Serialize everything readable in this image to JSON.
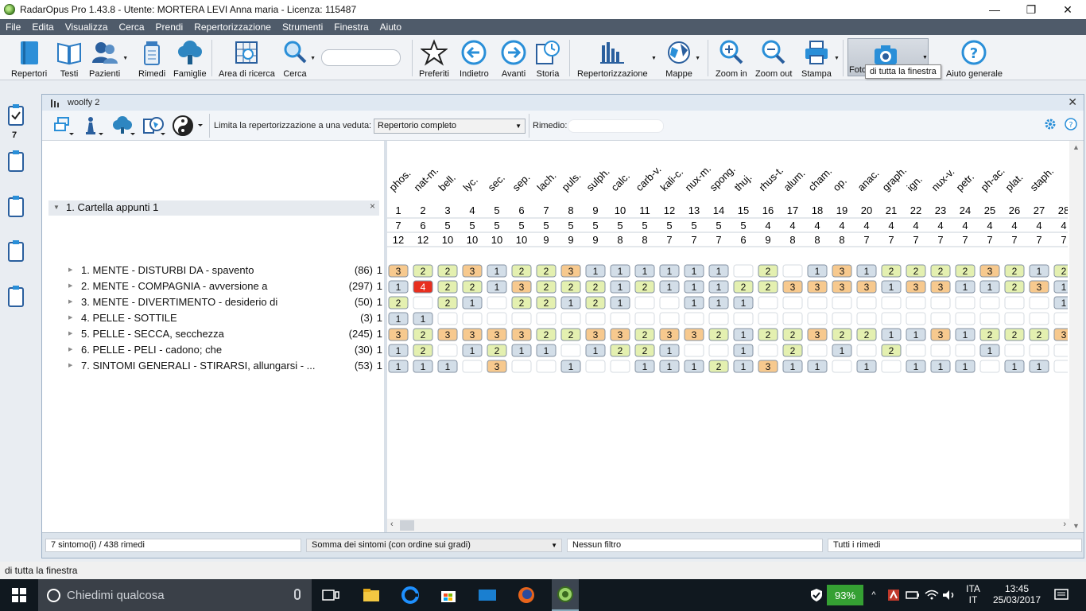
{
  "window": {
    "title": "RadarOpus Pro 1.43.8 - Utente: MORTERA LEVI Anna maria - Licenza: 115487"
  },
  "menu": [
    "File",
    "Edita",
    "Visualizza",
    "Cerca",
    "Prendi",
    "Repertorizzazione",
    "Strumenti",
    "Finestra",
    "Aiuto"
  ],
  "toolbar": {
    "repertori": "Repertori",
    "testi": "Testi",
    "pazienti": "Pazienti",
    "rimedi": "Rimedi",
    "famiglie": "Famiglie",
    "area_ricerca": "Area di ricerca",
    "cerca": "Cerca",
    "preferiti": "Preferiti",
    "indietro": "Indietro",
    "avanti": "Avanti",
    "storia": "Storia",
    "repertorizzazione": "Repertorizzazione",
    "mappe": "Mappe",
    "zoom_in": "Zoom in",
    "zoom_out": "Zoom out",
    "stampa": "Stampa",
    "foto": "Foto",
    "aiuto": "Aiuto generale",
    "tooltip": "di tutta la finestra"
  },
  "sidebar": {
    "clip_count": "7"
  },
  "panel": {
    "title": "woolfy 2",
    "limit_label": "Limita la repertorizzazione a una veduta:",
    "limit_value": "Repertorio completo",
    "rimedio_label": "Rimedio:",
    "folder": "1. Cartella appunti 1"
  },
  "symptoms": [
    {
      "text": "1. MENTE - DISTURBI DA - spavento",
      "count": "(86)",
      "w": "1"
    },
    {
      "text": "2. MENTE - COMPAGNIA - avversione a",
      "count": "(297)",
      "w": "1"
    },
    {
      "text": "3. MENTE - DIVERTIMENTO - desiderio di",
      "count": "(50)",
      "w": "1"
    },
    {
      "text": "4. PELLE - SOTTILE",
      "count": "(3)",
      "w": "1"
    },
    {
      "text": "5. PELLE - SECCA, secchezza",
      "count": "(245)",
      "w": "1"
    },
    {
      "text": "6. PELLE - PELI - cadono; che",
      "count": "(30)",
      "w": "1"
    },
    {
      "text": "7. SINTOMI GENERALI - STIRARSI, allungarsi - ...",
      "count": "(53)",
      "w": "1"
    }
  ],
  "remedies": [
    "phos.",
    "nat-m.",
    "bell.",
    "lyc.",
    "sec.",
    "sep.",
    "lach.",
    "puls.",
    "sulph.",
    "calc.",
    "carb-v.",
    "kali-c.",
    "nux-m.",
    "spong.",
    "thuj.",
    "rhus-t.",
    "alum.",
    "cham.",
    "op.",
    "anac.",
    "graph.",
    "ign.",
    "nux-v.",
    "petr.",
    "ph-ac.",
    "plat.",
    "staph.",
    ""
  ],
  "rank_row": [
    "1",
    "2",
    "3",
    "4",
    "5",
    "6",
    "7",
    "8",
    "9",
    "10",
    "11",
    "12",
    "13",
    "14",
    "15",
    "16",
    "17",
    "18",
    "19",
    "20",
    "21",
    "22",
    "23",
    "24",
    "25",
    "26",
    "27",
    "28"
  ],
  "symptoms_row": [
    "7",
    "6",
    "5",
    "5",
    "5",
    "5",
    "5",
    "5",
    "5",
    "5",
    "5",
    "5",
    "5",
    "5",
    "5",
    "4",
    "4",
    "4",
    "4",
    "4",
    "4",
    "4",
    "4",
    "4",
    "4",
    "4",
    "4",
    "4"
  ],
  "degrees_row": [
    "12",
    "12",
    "10",
    "10",
    "10",
    "10",
    "9",
    "9",
    "9",
    "8",
    "8",
    "7",
    "7",
    "7",
    "6",
    "9",
    "8",
    "8",
    "8",
    "7",
    "7",
    "7",
    "7",
    "7",
    "7",
    "7",
    "7",
    "7"
  ],
  "grades": [
    [
      "3",
      "2",
      "2",
      "3",
      "1",
      "2",
      "2",
      "3",
      "1",
      "1",
      "1",
      "1",
      "1",
      "1",
      "",
      "2",
      "",
      "1",
      "3",
      "1",
      "2",
      "2",
      "2",
      "2",
      "3",
      "2",
      "1",
      "2"
    ],
    [
      "1",
      "4",
      "2",
      "2",
      "1",
      "3",
      "2",
      "2",
      "2",
      "1",
      "2",
      "1",
      "1",
      "1",
      "2",
      "2",
      "3",
      "3",
      "3",
      "3",
      "1",
      "3",
      "3",
      "1",
      "1",
      "2",
      "3",
      "1"
    ],
    [
      "2",
      "",
      "2",
      "1",
      "",
      "2",
      "2",
      "1",
      "2",
      "1",
      "",
      "",
      "1",
      "1",
      "1",
      "",
      "",
      "",
      "",
      "",
      "",
      "",
      "",
      "",
      "",
      "",
      "",
      "1"
    ],
    [
      "1",
      "1",
      "",
      "",
      "",
      "",
      "",
      "",
      "",
      "",
      "",
      "",
      "",
      "",
      "",
      "",
      "",
      "",
      "",
      "",
      "",
      "",
      "",
      "",
      "",
      "",
      "",
      ""
    ],
    [
      "3",
      "2",
      "3",
      "3",
      "3",
      "3",
      "2",
      "2",
      "3",
      "3",
      "2",
      "3",
      "3",
      "2",
      "1",
      "2",
      "2",
      "3",
      "2",
      "2",
      "1",
      "1",
      "3",
      "1",
      "2",
      "2",
      "2",
      "3"
    ],
    [
      "1",
      "2",
      "",
      "1",
      "2",
      "1",
      "1",
      "",
      "1",
      "2",
      "2",
      "1",
      "",
      "",
      "1",
      "",
      "2",
      "",
      "1",
      "",
      "2",
      "",
      "",
      "",
      "1",
      "",
      "",
      ""
    ],
    [
      "1",
      "1",
      "1",
      "",
      "3",
      "",
      "",
      "1",
      "",
      "",
      "1",
      "1",
      "1",
      "2",
      "1",
      "3",
      "1",
      "1",
      "",
      "1",
      "",
      "1",
      "1",
      "1",
      "",
      "1",
      "1",
      ""
    ]
  ],
  "colors": {
    "g1": "#d3dee8",
    "g2": "#e4f0b0",
    "g3": "#f7c98e",
    "g4": "#e82f1f",
    "empty": "#ffffff"
  },
  "status": {
    "count": "7 sintomo(i) / 438 rimedi",
    "sort": "Somma dei sintomi (con ordine sui gradi)",
    "filter": "Nessun filtro",
    "remedies": "Tutti i rimedi"
  },
  "hint": "di tutta la finestra",
  "taskbar": {
    "search_placeholder": "Chiedimi qualcosa",
    "battery": "93%",
    "lang1": "ITA",
    "lang2": "IT",
    "time": "13:45",
    "date": "25/03/2017"
  }
}
